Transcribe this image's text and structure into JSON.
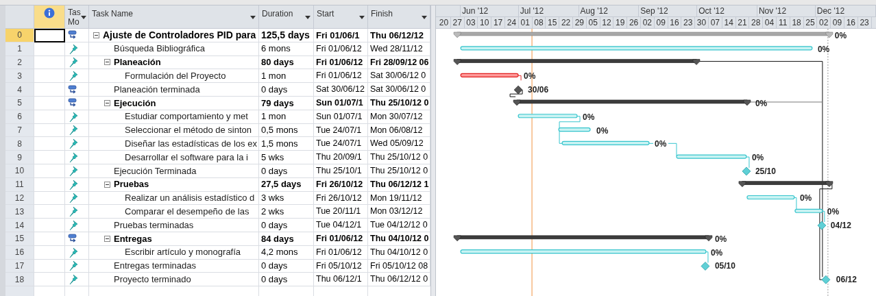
{
  "table": {
    "columns": [
      {
        "label": "Tas Mo"
      },
      {
        "label": "Task Name"
      },
      {
        "label": "Duration"
      },
      {
        "label": "Start"
      },
      {
        "label": "Finish"
      }
    ],
    "tasks": [
      {
        "id": "0",
        "manual": false,
        "name": "Ajuste de Controladores PID para",
        "duration": "125,5 days",
        "start": "Fri 01/06/1",
        "finish": "Thu 06/12/12",
        "selected": true,
        "expanded": true,
        "bar": {
          "kind": "project",
          "label": "0%"
        },
        "children": [
          {
            "id": "1",
            "manual": true,
            "name": "Búsqueda Bibliográfica",
            "duration": "6 mons",
            "start": "Fri 01/06/12",
            "finish": "Wed 28/11/12",
            "selected": false,
            "bar": {
              "kind": "task",
              "label": "0%"
            }
          },
          {
            "id": "2",
            "manual": true,
            "name": "Planeación",
            "duration": "80 days",
            "start": "Fri 01/06/12",
            "finish": "Fri 28/09/12 06",
            "selected": false,
            "expanded": true,
            "bar": {
              "kind": "summary"
            },
            "children": [
              {
                "id": "3",
                "manual": true,
                "name": "Formulación del Proyecto",
                "duration": "1 mon",
                "start": "Fri 01/06/12",
                "finish": "Sat 30/06/12 0",
                "selected": false,
                "bar": {
                  "kind": "critical",
                  "label": "0%"
                }
              }
            ]
          },
          {
            "id": "4",
            "manual": false,
            "name": "Planeación terminada",
            "duration": "0 days",
            "start": "Sat 30/06/12",
            "finish": "Sat 30/06/12 0",
            "selected": false,
            "bar": {
              "kind": "milestone_dark",
              "label": "30/06"
            }
          },
          {
            "id": "5",
            "manual": false,
            "name": "Ejecución",
            "duration": "79 days",
            "start": "Sun 01/07/1",
            "finish": "Thu 25/10/12 0",
            "selected": false,
            "expanded": true,
            "bar": {
              "kind": "summary",
              "label": "0%"
            },
            "children": [
              {
                "id": "6",
                "manual": true,
                "name": "Estudiar comportamiento y met",
                "duration": "1 mon",
                "start": "Sun 01/07/1",
                "finish": "Mon 30/07/12",
                "selected": false,
                "bar": {
                  "kind": "task",
                  "label": "0%"
                }
              },
              {
                "id": "7",
                "manual": true,
                "name": "Seleccionar el método de sinton",
                "duration": "0,5 mons",
                "start": "Tue 24/07/1",
                "finish": "Mon 06/08/12",
                "selected": false,
                "bar": {
                  "kind": "task",
                  "label": "0%"
                }
              },
              {
                "id": "8",
                "manual": true,
                "name": "Diseñar las estadísticas de los ex",
                "duration": "1,5 mons",
                "start": "Tue 24/07/1",
                "finish": "Wed 05/09/12",
                "selected": false,
                "bar": {
                  "kind": "task",
                  "label": "0%"
                }
              },
              {
                "id": "9",
                "manual": true,
                "name": "Desarrollar el software para la i",
                "duration": "5 wks",
                "start": "Thu 20/09/1",
                "finish": "Thu 25/10/12 0",
                "selected": false,
                "bar": {
                  "kind": "task",
                  "label": "0%"
                }
              }
            ]
          },
          {
            "id": "10",
            "manual": true,
            "name": "Ejecución Terminada",
            "duration": "0 days",
            "start": "Thu 25/10/1",
            "finish": "Thu 25/10/12 0",
            "selected": false,
            "bar": {
              "kind": "milestone",
              "label": "25/10"
            }
          },
          {
            "id": "11",
            "manual": true,
            "name": "Pruebas",
            "duration": "27,5 days",
            "start": "Fri 26/10/12",
            "finish": "Thu 06/12/12 1",
            "selected": false,
            "expanded": true,
            "bar": {
              "kind": "summary"
            },
            "children": [
              {
                "id": "12",
                "manual": true,
                "name": "Realizar un análisis estadístico d",
                "duration": "3 wks",
                "start": "Fri 26/10/12",
                "finish": "Mon 19/11/12",
                "selected": false,
                "bar": {
                  "kind": "task",
                  "label": "0%"
                }
              },
              {
                "id": "13",
                "manual": true,
                "name": "Comparar el desempeño de las",
                "duration": "2 wks",
                "start": "Tue 20/11/1",
                "finish": "Mon 03/12/12",
                "selected": false,
                "bar": {
                  "kind": "task",
                  "label": "0%"
                }
              }
            ]
          },
          {
            "id": "14",
            "manual": true,
            "name": "Pruebas terminadas",
            "duration": "0 days",
            "start": "Tue 04/12/1",
            "finish": "Tue 04/12/12 0",
            "selected": false,
            "bar": {
              "kind": "milestone",
              "label": "04/12"
            }
          },
          {
            "id": "15",
            "manual": false,
            "name": "Entregas",
            "duration": "84 days",
            "start": "Fri 01/06/12",
            "finish": "Thu 04/10/12 0",
            "selected": false,
            "expanded": true,
            "bar": {
              "kind": "summary",
              "label": "0%"
            },
            "children": [
              {
                "id": "16",
                "manual": true,
                "name": "Escribir artículo y monografía",
                "duration": "4,2 mons",
                "start": "Fri 01/06/12",
                "finish": "Thu 04/10/12 0",
                "selected": false,
                "bar": {
                  "kind": "task",
                  "label": "0%"
                }
              }
            ]
          },
          {
            "id": "17",
            "manual": true,
            "name": "Entregas terminadas",
            "duration": "0 days",
            "start": "Fri 05/10/12",
            "finish": "Fri 05/10/12 08",
            "selected": false,
            "bar": {
              "kind": "milestone",
              "label": "05/10"
            }
          },
          {
            "id": "18",
            "manual": true,
            "name": "Proyecto terminado",
            "duration": "0 days",
            "start": "Thu 06/12/1",
            "finish": "Thu 06/12/12 0",
            "selected": false,
            "bar": {
              "kind": "milestone",
              "label": "06/12"
            }
          }
        ]
      }
    ]
  },
  "timescale": {
    "months": [
      "Jun '12",
      "Jul '12",
      "Aug '12",
      "Sep '12",
      "Oct '12",
      "Nov '12",
      "Dec '12"
    ],
    "weeks": [
      "20",
      "27",
      "03",
      "10",
      "17",
      "24",
      "01",
      "08",
      "15",
      "22",
      "29",
      "05",
      "12",
      "19",
      "26",
      "02",
      "09",
      "16",
      "23",
      "30",
      "07",
      "14",
      "21",
      "28",
      "04",
      "11",
      "18",
      "25",
      "02",
      "09",
      "16",
      "23"
    ]
  }
}
